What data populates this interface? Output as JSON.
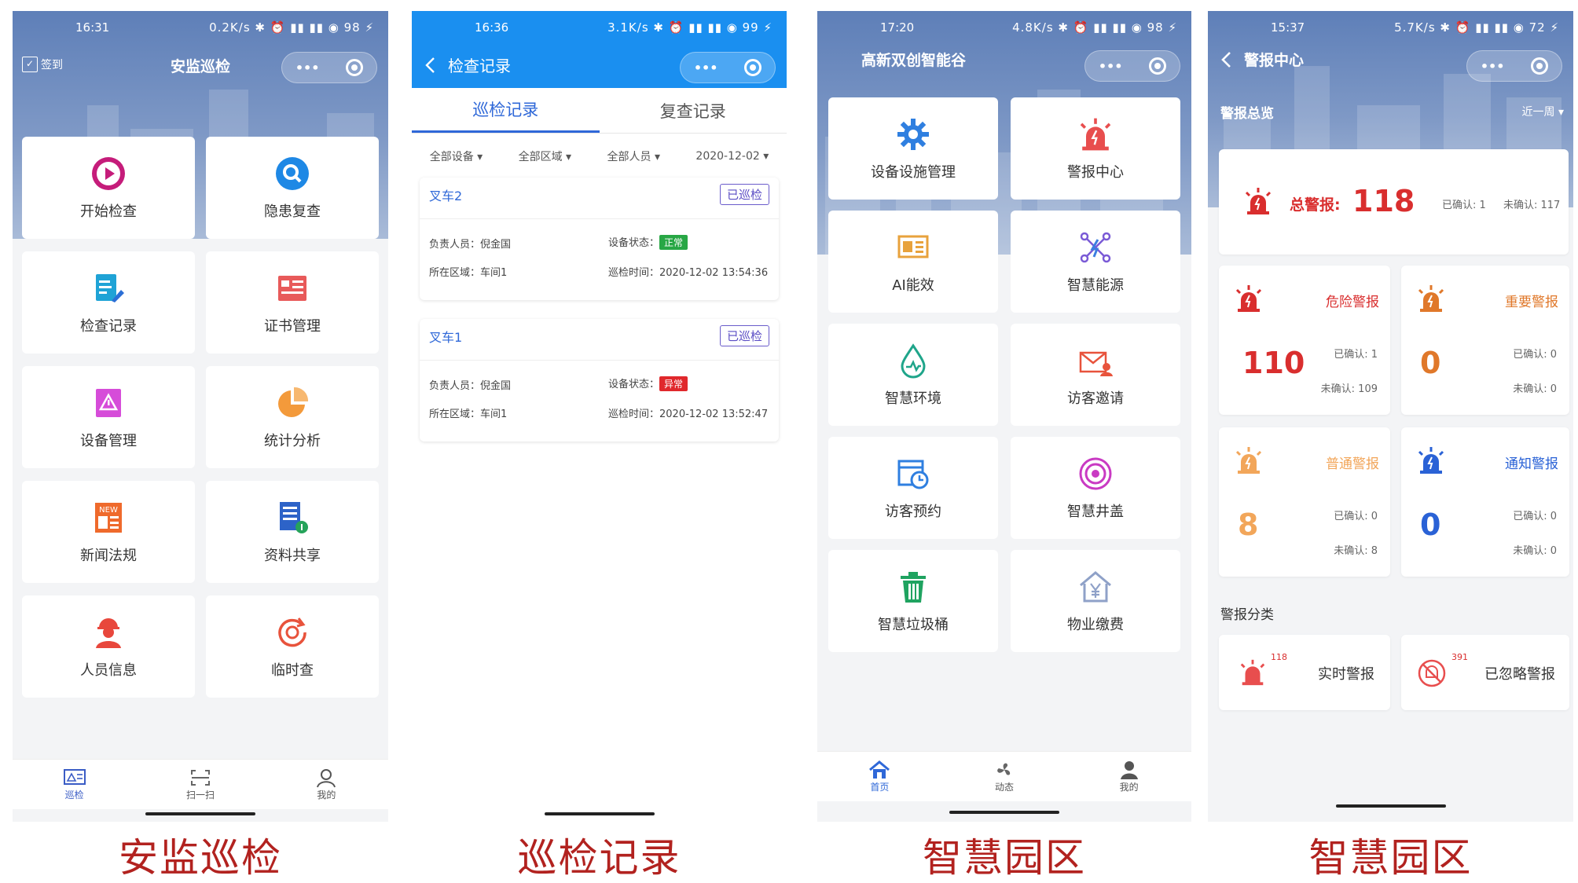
{
  "phone1": {
    "status": {
      "time": "16:31",
      "net": "0.2K/s ✱ ⏰ ▮▮ ▮▮ ◉ 98 ⚡"
    },
    "checkin": "签到",
    "title": "安监巡检",
    "capsule_more": "•••",
    "tiles": [
      {
        "label": "开始检查",
        "icon": "play-circle-icon"
      },
      {
        "label": "隐患复查",
        "icon": "search-circle-icon"
      },
      {
        "label": "检查记录",
        "icon": "document-edit-icon"
      },
      {
        "label": "证书管理",
        "icon": "certificate-icon"
      },
      {
        "label": "设备管理",
        "icon": "warning-device-icon"
      },
      {
        "label": "统计分析",
        "icon": "pie-chart-icon"
      },
      {
        "label": "新闻法规",
        "icon": "news-icon"
      },
      {
        "label": "资料共享",
        "icon": "file-share-icon"
      },
      {
        "label": "人员信息",
        "icon": "worker-icon"
      },
      {
        "label": "临时查",
        "icon": "refresh-target-icon"
      }
    ],
    "tabbar": [
      {
        "label": "巡检",
        "icon": "inspect-icon"
      },
      {
        "label": "扫一扫",
        "icon": "scan-icon"
      },
      {
        "label": "我的",
        "icon": "user-icon"
      }
    ],
    "caption": "安监巡检"
  },
  "phone2": {
    "status": {
      "time": "16:36",
      "net": "3.1K/s ✱ ⏰ ▮▮ ▮▮ ◉ 99 ⚡"
    },
    "title": "检查记录",
    "capsule_more": "•••",
    "tabs": [
      "巡检记录",
      "复查记录"
    ],
    "filters": [
      "全部设备 ▾",
      "全部区域 ▾",
      "全部人员 ▾",
      "2020-12-02 ▾"
    ],
    "records": [
      {
        "name": "叉车2",
        "badge": "已巡检",
        "person_label": "负责人员：",
        "person": "倪金国",
        "status_label": "设备状态：",
        "status": "正常",
        "area_label": "所在区域：",
        "area": "车间1",
        "time_label": "巡检时间：",
        "time": "2020-12-02 13:54:36"
      },
      {
        "name": "叉车1",
        "badge": "已巡检",
        "person_label": "负责人员：",
        "person": "倪金国",
        "status_label": "设备状态：",
        "status": "异常",
        "area_label": "所在区域：",
        "area": "车间1",
        "time_label": "巡检时间：",
        "time": "2020-12-02 13:52:47"
      }
    ],
    "caption": "巡检记录"
  },
  "phone3": {
    "status": {
      "time": "17:20",
      "net": "4.8K/s ✱ ⏰ ▮▮ ▮▮ ◉ 98 ⚡"
    },
    "title": "高新双创智能谷",
    "capsule_more": "•••",
    "tiles": [
      {
        "label": "设备设施管理",
        "icon": "gear-icon"
      },
      {
        "label": "警报中心",
        "icon": "alarm-icon"
      },
      {
        "label": "AI能效",
        "icon": "ai-board-icon"
      },
      {
        "label": "智慧能源",
        "icon": "energy-nodes-icon"
      },
      {
        "label": "智慧环境",
        "icon": "water-drop-icon"
      },
      {
        "label": "访客邀请",
        "icon": "mail-invite-icon"
      },
      {
        "label": "访客预约",
        "icon": "calendar-clock-icon"
      },
      {
        "label": "智慧井盖",
        "icon": "manhole-icon"
      },
      {
        "label": "智慧垃圾桶",
        "icon": "trash-icon"
      },
      {
        "label": "物业缴费",
        "icon": "house-yen-icon"
      }
    ],
    "tabbar": [
      {
        "label": "首页",
        "icon": "home-icon"
      },
      {
        "label": "动态",
        "icon": "fan-icon"
      },
      {
        "label": "我的",
        "icon": "user-icon"
      }
    ],
    "caption": "智慧园区"
  },
  "phone4": {
    "status": {
      "time": "15:37",
      "net": "5.7K/s ✱ ⏰ ▮▮ ▮▮ ◉ 72 ⚡"
    },
    "title": "警报中心",
    "capsule_more": "•••",
    "overview": "警报总览",
    "range": "近一周 ▾",
    "total_label": "总警报:",
    "total": "118",
    "total_confirmed": "已确认: 1",
    "total_unconfirmed": "未确认: 117",
    "cards": [
      {
        "name": "危险警报",
        "count": "110",
        "confirmed": "已确认: 1",
        "unconfirmed": "未确认: 109",
        "color": "#d92e2e"
      },
      {
        "name": "重要警报",
        "count": "0",
        "confirmed": "已确认: 0",
        "unconfirmed": "未确认: 0",
        "color": "#e0782a"
      },
      {
        "name": "普通警报",
        "count": "8",
        "confirmed": "已确认: 0",
        "unconfirmed": "未确认: 8",
        "color": "#f2a65a"
      },
      {
        "name": "通知警报",
        "count": "0",
        "confirmed": "已确认: 0",
        "unconfirmed": "未确认: 0",
        "color": "#2a62d6"
      }
    ],
    "category_title": "警报分类",
    "categories": [
      {
        "name": "实时警报",
        "count": "118"
      },
      {
        "name": "已忽略警报",
        "count": "391"
      }
    ],
    "caption": "智慧园区"
  }
}
